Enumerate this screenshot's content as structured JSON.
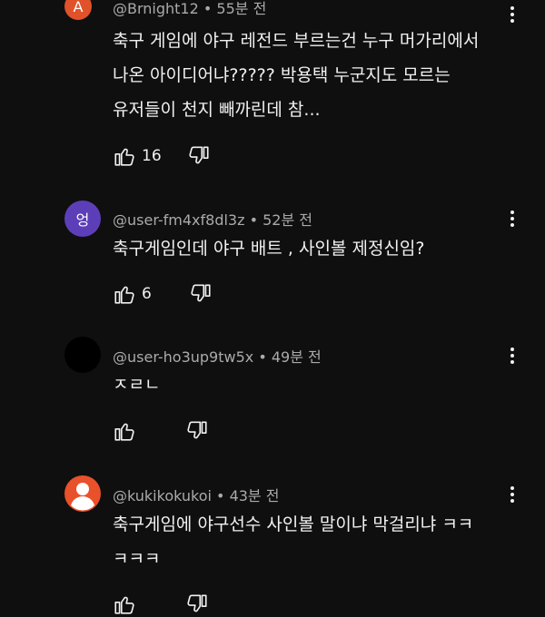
{
  "comments": [
    {
      "author": "@Brnight12",
      "time": "55분 전",
      "avatar_letter": "A",
      "avatar_color": "#e0522a",
      "text": "축구 게임에 야구 레전드 부르는건 누구 머가리에서\n나온 아이디어냐????? 박용택 누군지도 모르는\n유저들이 천지 빼까린데 참...",
      "likes": "16"
    },
    {
      "author": "@user-fm4xf8dl3z",
      "time": "52분 전",
      "avatar_letter": "엉",
      "avatar_color": "#5c3fb8",
      "text": "축구게임인데 야구 배트 , 사인볼 제정신임?",
      "likes": "6"
    },
    {
      "author": "@user-ho3up9tw5x",
      "time": "49분 전",
      "avatar_letter": "",
      "avatar_color": "#000000",
      "text": "ㅈㄹㄴ",
      "likes": ""
    },
    {
      "author": "@kukikokukoi",
      "time": "43분 전",
      "avatar_letter": "",
      "avatar_color": "#e8512a",
      "text": "축구게임에 야구선수 사인볼 말이냐 막걸리냐 ㅋㅋ\nㅋㅋㅋ",
      "likes": ""
    }
  ],
  "separator": " • "
}
